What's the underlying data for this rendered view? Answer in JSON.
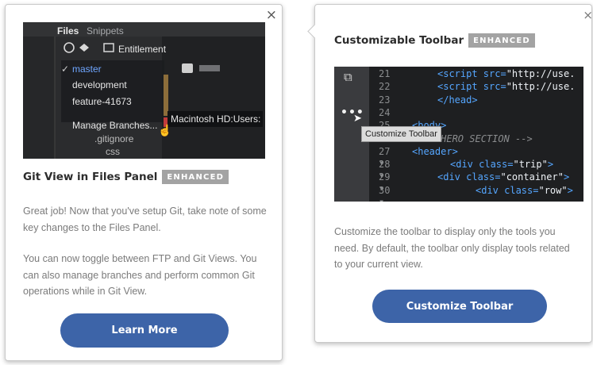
{
  "left_card": {
    "close": "×",
    "screenshot": {
      "tabs": [
        "Files",
        "Snippets"
      ],
      "entitlement": "Entitlement",
      "branches": [
        {
          "label": "master",
          "current": true
        },
        {
          "label": "development",
          "current": false
        },
        {
          "label": "feature-41673",
          "current": false
        }
      ],
      "manage_branches": "Manage Branches...",
      "path": "Macintosh HD:Users:",
      "gitignore": ".gitignore",
      "css": "css"
    },
    "title": "Git View in Files Panel",
    "badge": "ENHANCED",
    "paragraph1": "Great job! Now that you've setup Git, take note of some key changes to the Files Panel.",
    "paragraph2": "You can now toggle between FTP and Git Views. You can also manage branches and perform common Git operations while in Git View.",
    "button": "Learn More"
  },
  "right_card": {
    "close": "×",
    "title": "Customizable Toolbar",
    "badge": "ENHANCED",
    "screenshot": {
      "tooltip": "Customize Toolbar",
      "lines": [
        {
          "n": "21",
          "fold": false,
          "code": "<script src=\"http://use."
        },
        {
          "n": "22",
          "fold": false,
          "code": "<script src=\"http://use."
        },
        {
          "n": "23",
          "fold": false,
          "code": "</head>"
        },
        {
          "n": "24",
          "fold": false,
          "code": ""
        },
        {
          "n": "25",
          "fold": true,
          "code": "<body>"
        },
        {
          "n": "26",
          "fold": false,
          "code": "<!-- HERO SECTION -->"
        },
        {
          "n": "27",
          "fold": true,
          "code": "<header>"
        },
        {
          "n": "28",
          "fold": true,
          "code": "<div class=\"trip\">"
        },
        {
          "n": "29",
          "fold": true,
          "code": "<div class=\"container\">"
        },
        {
          "n": "30",
          "fold": true,
          "code": "<div class=\"row\">"
        }
      ]
    },
    "paragraph": "Customize the toolbar to display only the tools you need. By default, the toolbar only display tools related to your current view.",
    "button": "Customize Toolbar"
  }
}
